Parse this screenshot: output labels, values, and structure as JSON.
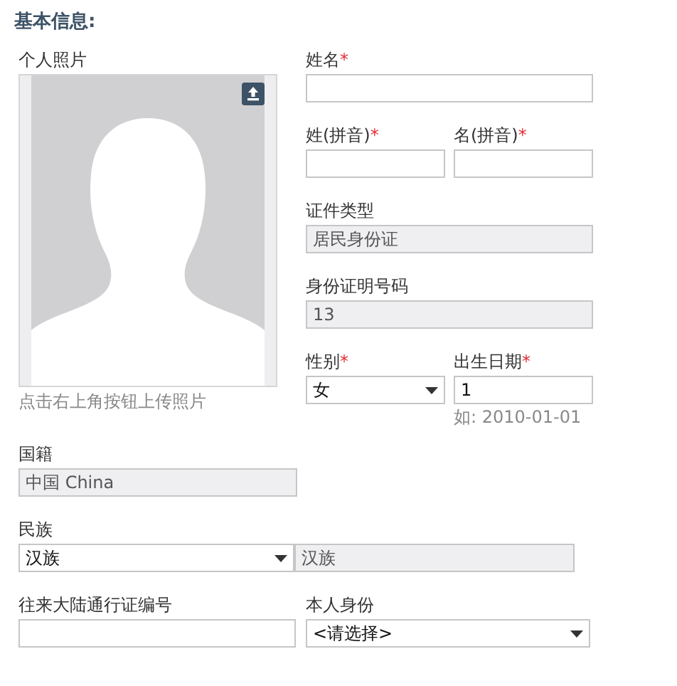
{
  "section_title": "基本信息:",
  "photo": {
    "label": "个人照片",
    "caption": "点击右上角按钮上传照片"
  },
  "right_rows": [
    [
      {
        "label": "姓名",
        "required_mark": "*",
        "kind": "text"
      }
    ],
    [
      {
        "label": "姓(拼音)",
        "required_mark": "*",
        "kind": "text"
      },
      {
        "label": "名(拼音)",
        "required_mark": "*",
        "kind": "text"
      }
    ],
    [
      {
        "label": "证件类型",
        "kind": "readonly",
        "value": "居民身份证"
      }
    ],
    [
      {
        "label": "身份证明号码",
        "kind": "readonly",
        "value": "13"
      }
    ],
    [
      {
        "label": "性别",
        "required_mark": "*",
        "kind": "select",
        "value": "女"
      },
      {
        "label": "出生日期",
        "required_mark": "*",
        "kind": "text",
        "value": "1",
        "hint": "如: 2010-01-01"
      }
    ]
  ],
  "bottom_rows": [
    [
      {
        "label": "国籍",
        "kind": "readonly",
        "value": "中国 China"
      }
    ],
    [
      {
        "label": "民族",
        "kind": "select",
        "value": "汉族",
        "display": "汉族"
      }
    ],
    [
      {
        "label": "往来大陆通行证编号",
        "kind": "text"
      },
      {
        "label": "本人身份",
        "kind": "select",
        "value": "<请选择>"
      }
    ]
  ]
}
